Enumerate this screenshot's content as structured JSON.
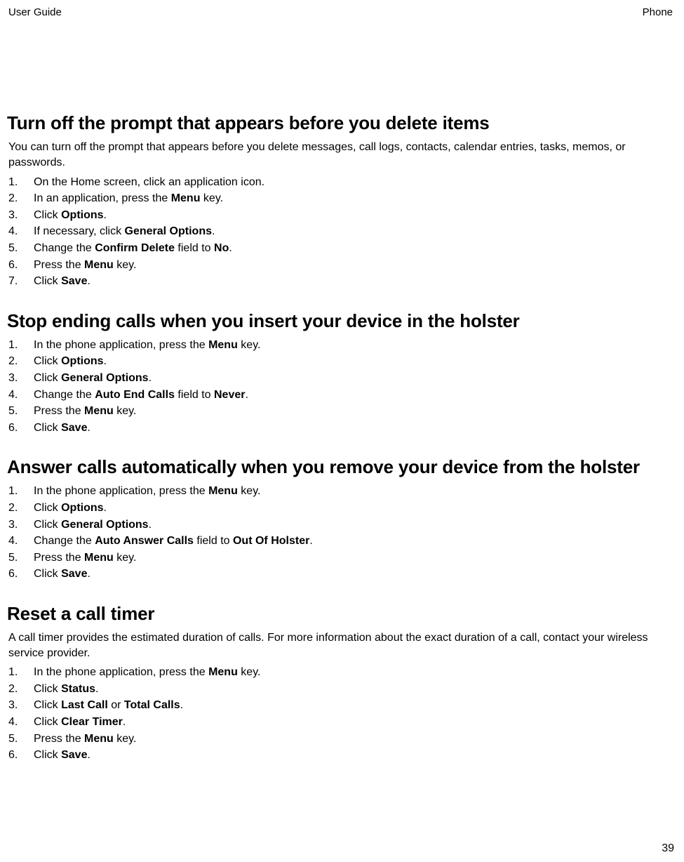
{
  "header": {
    "left": "User Guide",
    "right": "Phone"
  },
  "page_number": "39",
  "sections": [
    {
      "heading": "Turn off the prompt that appears before you delete items",
      "intro": "You can turn off the prompt that appears before you delete messages, call logs, contacts, calendar entries, tasks, memos, or passwords.",
      "steps": [
        [
          {
            "t": "On the Home screen, click an application icon."
          }
        ],
        [
          {
            "t": "In an application, press the "
          },
          {
            "b": "Menu"
          },
          {
            "t": " key."
          }
        ],
        [
          {
            "t": "Click "
          },
          {
            "b": "Options"
          },
          {
            "t": "."
          }
        ],
        [
          {
            "t": "If necessary, click "
          },
          {
            "b": "General Options"
          },
          {
            "t": "."
          }
        ],
        [
          {
            "t": "Change the "
          },
          {
            "b": "Confirm Delete"
          },
          {
            "t": " field to "
          },
          {
            "b": "No"
          },
          {
            "t": "."
          }
        ],
        [
          {
            "t": "Press the "
          },
          {
            "b": "Menu"
          },
          {
            "t": " key."
          }
        ],
        [
          {
            "t": "Click "
          },
          {
            "b": "Save"
          },
          {
            "t": "."
          }
        ]
      ]
    },
    {
      "heading": "Stop ending calls when you insert your device in the holster",
      "intro": "",
      "steps": [
        [
          {
            "t": "In the phone application, press the "
          },
          {
            "b": "Menu"
          },
          {
            "t": " key."
          }
        ],
        [
          {
            "t": "Click "
          },
          {
            "b": "Options"
          },
          {
            "t": "."
          }
        ],
        [
          {
            "t": "Click "
          },
          {
            "b": "General Options"
          },
          {
            "t": "."
          }
        ],
        [
          {
            "t": "Change the "
          },
          {
            "b": "Auto End Calls"
          },
          {
            "t": " field to "
          },
          {
            "b": "Never"
          },
          {
            "t": "."
          }
        ],
        [
          {
            "t": "Press the "
          },
          {
            "b": "Menu"
          },
          {
            "t": " key."
          }
        ],
        [
          {
            "t": "Click "
          },
          {
            "b": "Save"
          },
          {
            "t": "."
          }
        ]
      ]
    },
    {
      "heading": "Answer calls automatically when you remove your device from the holster",
      "intro": "",
      "steps": [
        [
          {
            "t": "In the phone application, press the "
          },
          {
            "b": "Menu"
          },
          {
            "t": " key."
          }
        ],
        [
          {
            "t": "Click "
          },
          {
            "b": "Options"
          },
          {
            "t": "."
          }
        ],
        [
          {
            "t": "Click "
          },
          {
            "b": "General Options"
          },
          {
            "t": "."
          }
        ],
        [
          {
            "t": "Change the "
          },
          {
            "b": "Auto Answer Calls"
          },
          {
            "t": " field to "
          },
          {
            "b": "Out Of Holster"
          },
          {
            "t": "."
          }
        ],
        [
          {
            "t": "Press the "
          },
          {
            "b": "Menu"
          },
          {
            "t": " key."
          }
        ],
        [
          {
            "t": "Click "
          },
          {
            "b": "Save"
          },
          {
            "t": "."
          }
        ]
      ]
    },
    {
      "heading": "Reset a call timer",
      "intro": "A call timer provides the estimated duration of calls. For more information about the exact duration of a call, contact your wireless service provider.",
      "steps": [
        [
          {
            "t": "In the phone application, press the "
          },
          {
            "b": "Menu"
          },
          {
            "t": " key."
          }
        ],
        [
          {
            "t": "Click "
          },
          {
            "b": "Status"
          },
          {
            "t": "."
          }
        ],
        [
          {
            "t": "Click "
          },
          {
            "b": "Last Call"
          },
          {
            "t": " or "
          },
          {
            "b": "Total Calls"
          },
          {
            "t": "."
          }
        ],
        [
          {
            "t": "Click "
          },
          {
            "b": "Clear Timer"
          },
          {
            "t": "."
          }
        ],
        [
          {
            "t": "Press the "
          },
          {
            "b": "Menu"
          },
          {
            "t": " key."
          }
        ],
        [
          {
            "t": "Click "
          },
          {
            "b": "Save"
          },
          {
            "t": "."
          }
        ]
      ]
    }
  ]
}
